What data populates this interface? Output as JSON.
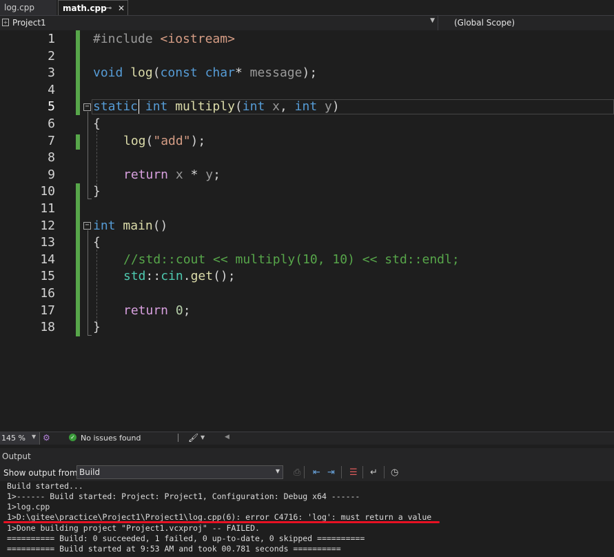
{
  "tabs": [
    {
      "label": "log.cpp"
    },
    {
      "label": "math.cpp",
      "pin": "⊸",
      "close": "✕"
    }
  ],
  "nav": {
    "project": "Project1",
    "scope": "(Global Scope)"
  },
  "editor": {
    "line_numbers": [
      "1",
      "2",
      "3",
      "4",
      "5",
      "6",
      "7",
      "8",
      "9",
      "10",
      "11",
      "12",
      "13",
      "14",
      "15",
      "16",
      "17",
      "18"
    ],
    "lines": {
      "l1": {
        "a": "#include ",
        "b": "<iostream>"
      },
      "l3": {
        "a": "void ",
        "b": "log",
        "c": "(",
        "d": "const ",
        "e": "char",
        "f": "* ",
        "g": "message",
        "h": ");"
      },
      "l5": {
        "a": "static",
        "b": " int ",
        "c": "multiply",
        "d": "(",
        "e": "int ",
        "f": "x",
        "g": ", ",
        "h": "int ",
        "i": "y",
        "j": ")"
      },
      "l6": "{",
      "l7": {
        "a": "log",
        "b": "(",
        "c": "\"add\"",
        "d": ");"
      },
      "l9": {
        "a": "return ",
        "b": "x",
        "c": " * ",
        "d": "y",
        "e": ";"
      },
      "l10": "}",
      "l12": {
        "a": "int ",
        "b": "main",
        "c": "()"
      },
      "l13": "{",
      "l14": "//std::cout << multiply(10, 10) << std::endl;",
      "l15": {
        "a": "std",
        "b": "::",
        "c": "cin",
        "d": ".",
        "e": "get",
        "f": "();"
      },
      "l17": {
        "a": "return ",
        "b": "0",
        "c": ";"
      },
      "l18": "}"
    }
  },
  "status": {
    "zoom": "145 %",
    "issues": "No issues found"
  },
  "output": {
    "title": "Output",
    "show_from_label": "Show output from:",
    "source": "Build",
    "lines": [
      "Build started...",
      "1>------ Build started: Project: Project1, Configuration: Debug x64 ------",
      "1>log.cpp",
      "1>D:\\gitee\\practice\\Project1\\Project1\\log.cpp(6): error C4716: 'log': must return a value",
      "1>Done building project \"Project1.vcxproj\" -- FAILED.",
      "========== Build: 0 succeeded, 1 failed, 0 up-to-date, 0 skipped ==========",
      "========== Build started at 9:53 AM and took 00.781 seconds =========="
    ]
  },
  "colors": {
    "accent_underline": "#e81123",
    "change_bar": "#57a64a",
    "keyword": "#569cd6"
  }
}
